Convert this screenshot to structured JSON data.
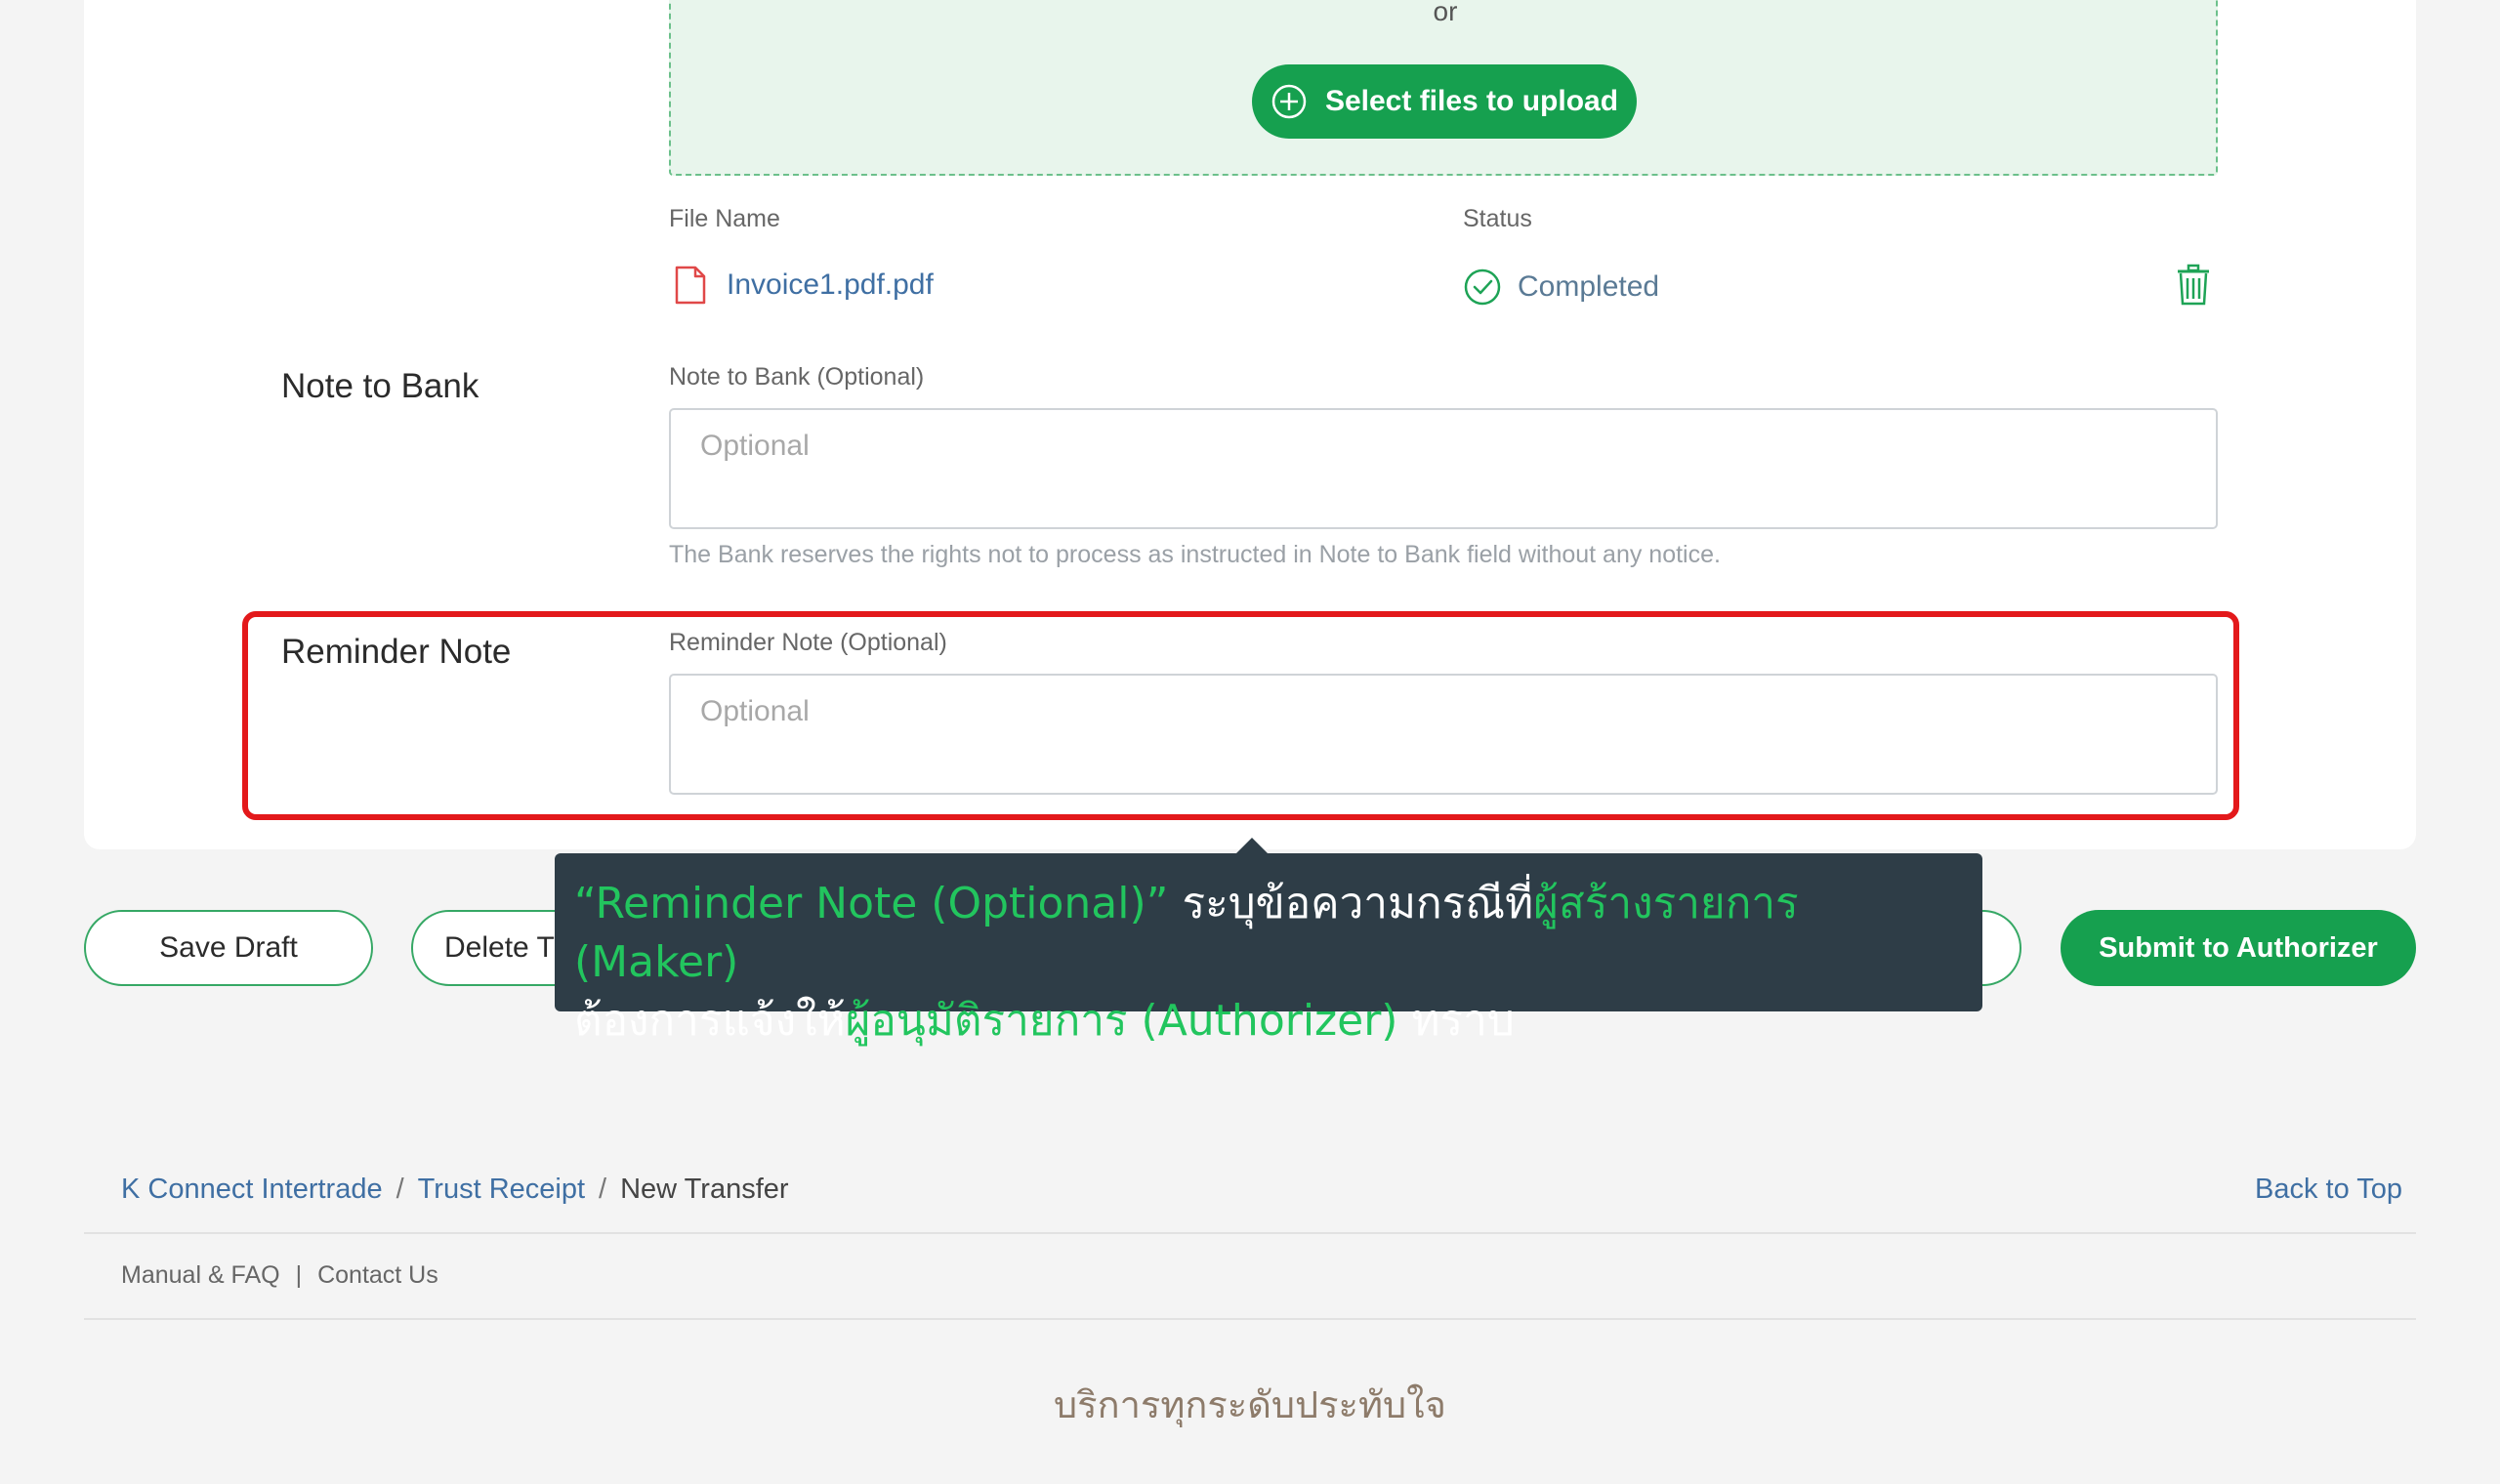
{
  "upload": {
    "or_text": "or",
    "select_button_label": "Select files to upload"
  },
  "files": {
    "col_name_label": "File Name",
    "col_status_label": "Status",
    "rows": [
      {
        "name": "Invoice1.pdf.pdf",
        "status": "Completed"
      }
    ]
  },
  "note_to_bank": {
    "section_title": "Note to Bank",
    "field_label": "Note to Bank (Optional)",
    "placeholder": "Optional",
    "hint": "The Bank reserves the rights not to process as instructed in Note to Bank field without any notice."
  },
  "reminder_note": {
    "section_title": "Reminder Note",
    "field_label": "Reminder Note (Optional)",
    "placeholder": "Optional"
  },
  "actions": {
    "save_draft_label": "Save Draft",
    "delete_label": "Delete Tr",
    "submit_label": "Submit to Authorizer"
  },
  "tooltip": {
    "part1": "“Reminder Note (Optional)”",
    "part2": " ระบุข้อความกรณีที่",
    "part3": "ผู้สร้างรายการ (Maker)",
    "part4": "ต้องการแจ้งให้",
    "part5": "ผู้อนุมัติรายการ (Authorizer)",
    "part6": " ทราบ"
  },
  "breadcrumb": {
    "item1": "K Connect Intertrade",
    "item2": "Trust Receipt",
    "item3": "New Transfer",
    "separator": "/"
  },
  "footer": {
    "back_to_top": "Back to Top",
    "manual_faq": "Manual & FAQ",
    "separator": "|",
    "contact_us": "Contact Us",
    "slogan": "บริการทุกระดับประทับใจ"
  },
  "colors": {
    "brand_green": "#16a04f",
    "highlight_red": "#e3191b",
    "link_blue": "#3f6fa3",
    "tooltip_bg": "#2e3d47"
  }
}
